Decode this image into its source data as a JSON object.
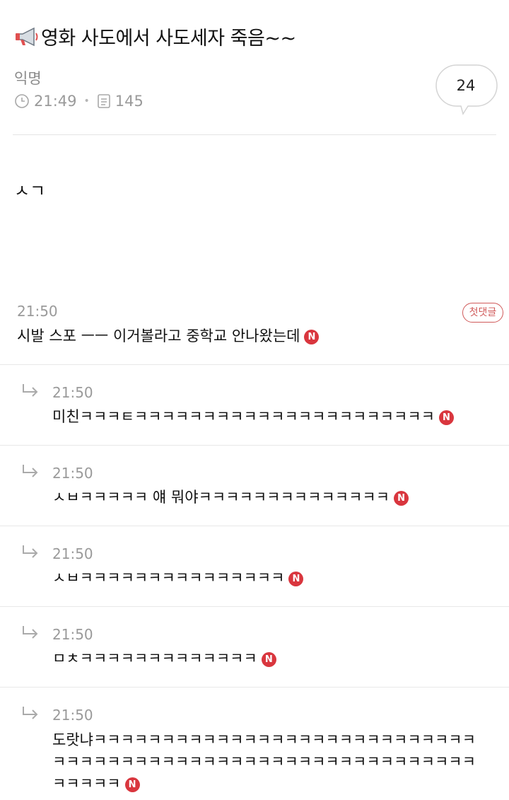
{
  "post": {
    "title": "영화 사도에서 사도세자 죽음~~",
    "author": "익명",
    "time": "21:49",
    "views": "145",
    "comment_count": "24",
    "body": "ㅅㄱ"
  },
  "icons": {
    "title": "megaphone-icon",
    "time": "clock-icon",
    "views": "document-icon",
    "comments": "speech-bubble-icon",
    "reply": "reply-arrow-icon",
    "new": "new-badge-icon"
  },
  "badges": {
    "first_comment": "첫댓글",
    "new": "N"
  },
  "colors": {
    "new_badge": "#d9363e",
    "first_badge": "#d05a5a",
    "muted": "#9a9a9a"
  },
  "comments": [
    {
      "time": "21:50",
      "text": "시발 스포 ㅡㅡ 이거볼라고 중학교 안나왔는데"
    },
    {
      "time": "21:50",
      "text": "미친ㅋㅋㅋㅌㅋㅋㅋㅋㅋㅋㅋㅋㅋㅋㅋㅋㅋㅋㅋㅋㅋㅋㅋㅋㅋㅋ"
    },
    {
      "time": "21:50",
      "text": "ㅅㅂㅋㅋㅋㅋㅋ 얘 뭐야ㅋㅋㅋㅋㅋㅋㅋㅋㅋㅋㅋㅋㅋㅋ"
    },
    {
      "time": "21:50",
      "text": "ㅅㅂㅋㅋㅋㅋㅋㅋㅋㅋㅋㅋㅋㅋㅋㅋㅋ"
    },
    {
      "time": "21:50",
      "text": "ㅁㅊㅋㅋㅋㅋㅋㅋㅋㅋㅋㅋㅋㅋㅋ"
    },
    {
      "time": "21:50",
      "text": "도랏냐ㅋㅋㅋㅋㅋㅋㅋㅋㅋㅋㅋㅋㅋㅋㅋㅋㅋㅋㅋㅋㅋㅋㅋㅋㅋㅋㅋㅋㅋㅋㅋㅋㅋㅋㅋㅋㅋㅋㅋㅋㅋㅋㅋㅋㅋㅋㅋㅋㅋㅋㅋㅋㅋㅋㅋㅋㅋㅋㅋㅋㅋㅋㅋㅋ"
    }
  ]
}
